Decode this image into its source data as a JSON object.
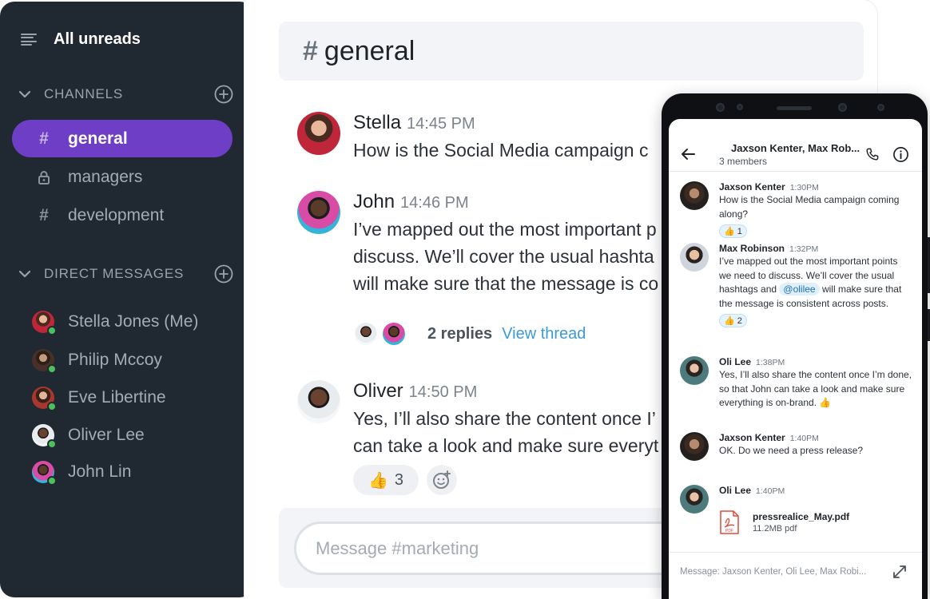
{
  "sidebar": {
    "title": "All unreads",
    "channels_label": "CHANNELS",
    "channels": [
      {
        "icon": "#",
        "label": "general",
        "active": true
      },
      {
        "icon": "lock",
        "label": "managers",
        "active": false
      },
      {
        "icon": "#",
        "label": "development",
        "active": false
      }
    ],
    "dm_label": "DIRECT MESSAGES",
    "dms": [
      {
        "label": "Stella Jones (Me)",
        "online": true
      },
      {
        "label": "Philip Mccoy",
        "online": true
      },
      {
        "label": "Eve Libertine",
        "online": true
      },
      {
        "label": "Oliver Lee",
        "online": true
      },
      {
        "label": "John Lin",
        "online": true
      }
    ]
  },
  "channel": {
    "hash": "#",
    "name": "general"
  },
  "messages": [
    {
      "sender": "Stella",
      "time": "14:45 PM",
      "text": " How is the Social Media campaign c"
    },
    {
      "sender": "John",
      "time": "14:46 PM",
      "text": "I’ve mapped out the most important p\ndiscuss. We’ll cover the usual hashta\nwill make sure that the message is co"
    },
    {
      "sender": "Oliver",
      "time": "14:50 PM",
      "text": "Yes, I’ll also share the content once I’\ncan take a look and make sure everyt"
    }
  ],
  "thread": {
    "count_label": "2 replies",
    "view_label": "View thread"
  },
  "reaction": {
    "emoji": "👍",
    "count": "3"
  },
  "composer": {
    "placeholder": "Message #marketing"
  },
  "phone": {
    "title": "Jaxson Kenter, Max Rob...",
    "subtitle": "3 members",
    "messages": [
      {
        "sender": "Jaxson Kenter",
        "time": "1:30PM",
        "text": "How is the Social Media campaign coming along?",
        "reaction": "👍 1"
      },
      {
        "sender": "Max Robinson",
        "time": "1:32PM",
        "text_a": "I’ve mapped out the most important points we need to discuss. We’ll cover the usual hashtags and ",
        "mention": "@olilee",
        "text_b": " will make sure that the message is consistent across posts.",
        "reaction": "👍 2"
      },
      {
        "sender": "Oli Lee",
        "time": "1:38PM",
        "text": "Yes, I’ll also share the content once I’m done, so that John can take a look and make sure everything is on-brand. 👍"
      },
      {
        "sender": "Jaxson Kenter",
        "time": "1:40PM",
        "text": "OK. Do we need a press release?"
      },
      {
        "sender": "Oli Lee",
        "time": "1:40PM"
      }
    ],
    "file": {
      "name": "pressrealice_May.pdf",
      "size": "11.2MB pdf",
      "badge": "PDF"
    },
    "composer_placeholder": "Message: Jaxson Kenter, Oli Lee, Max Robi..."
  },
  "colors": {
    "sidebar_bg": "#202932",
    "active_channel": "#6e3fc6",
    "online": "#4cc15a",
    "link": "#3b9bd8"
  }
}
